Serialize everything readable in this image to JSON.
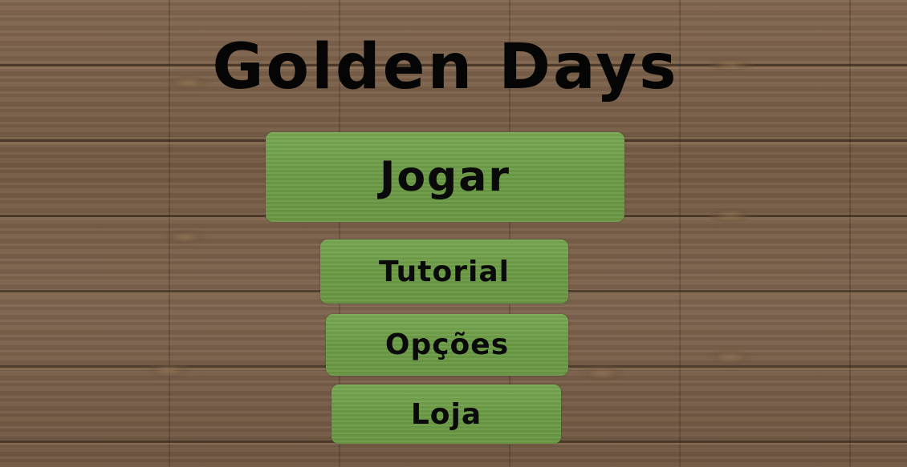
{
  "game": {
    "title": "Golden Days"
  },
  "menu": {
    "play_label": "Jogar",
    "tutorial_label": "Tutorial",
    "options_label": "Opções",
    "shop_label": "Loja"
  },
  "colors": {
    "background_wood": "#7a6148",
    "button_green": "#6f9f4a",
    "text": "#050505"
  }
}
